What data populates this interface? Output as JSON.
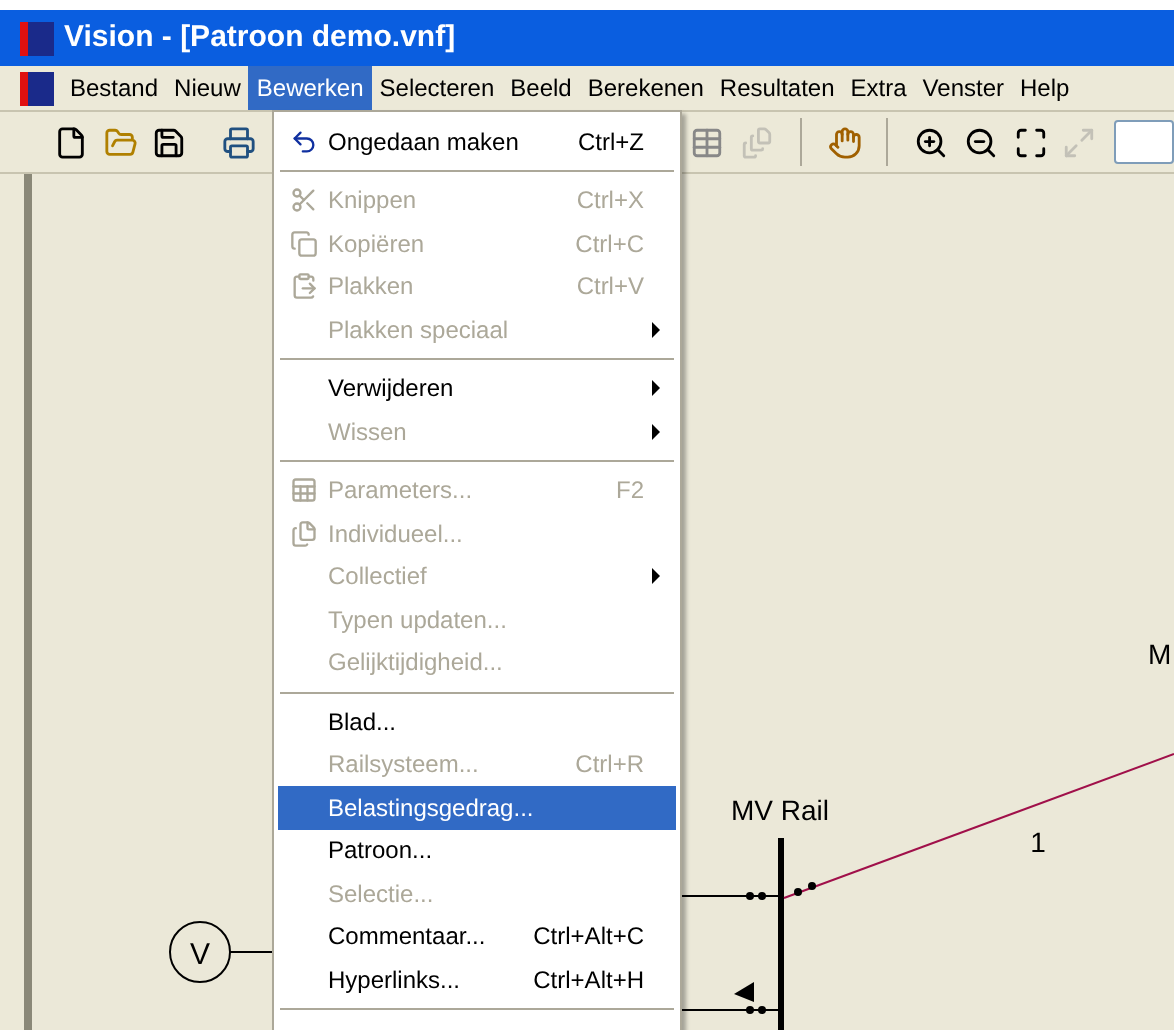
{
  "window": {
    "title": "Vision - [Patroon demo.vnf]"
  },
  "menu_bar": [
    {
      "label": "Bestand",
      "selected": false
    },
    {
      "label": "Nieuw",
      "selected": false
    },
    {
      "label": "Bewerken",
      "selected": true
    },
    {
      "label": "Selecteren",
      "selected": false
    },
    {
      "label": "Beeld",
      "selected": false
    },
    {
      "label": "Berekenen",
      "selected": false
    },
    {
      "label": "Resultaten",
      "selected": false
    },
    {
      "label": "Extra",
      "selected": false
    },
    {
      "label": "Venster",
      "selected": false
    },
    {
      "label": "Help",
      "selected": false
    }
  ],
  "menu": {
    "items": [
      {
        "kind": "item",
        "label": "Ongedaan maken",
        "shortcut": "Ctrl+Z",
        "disabled": false,
        "selected": false,
        "submenu": false
      },
      {
        "kind": "separator"
      },
      {
        "kind": "item",
        "label": "Knippen",
        "shortcut": "Ctrl+X",
        "disabled": true,
        "selected": false,
        "submenu": false
      },
      {
        "kind": "item",
        "label": "Kopiëren",
        "shortcut": "Ctrl+C",
        "disabled": true,
        "selected": false,
        "submenu": false
      },
      {
        "kind": "item",
        "label": "Plakken",
        "shortcut": "Ctrl+V",
        "disabled": true,
        "selected": false,
        "submenu": false
      },
      {
        "kind": "item",
        "label": "Plakken speciaal",
        "disabled": true,
        "selected": false,
        "submenu": true
      },
      {
        "kind": "separator"
      },
      {
        "kind": "item",
        "label": "Verwijderen",
        "disabled": false,
        "selected": false,
        "submenu": true
      },
      {
        "kind": "item",
        "label": "Wissen",
        "disabled": true,
        "selected": false,
        "submenu": true
      },
      {
        "kind": "separator"
      },
      {
        "kind": "item",
        "label": "Parameters...",
        "shortcut": "F2",
        "disabled": true,
        "selected": false,
        "submenu": false
      },
      {
        "kind": "item",
        "label": "Individueel...",
        "disabled": true,
        "selected": false,
        "submenu": false
      },
      {
        "kind": "item",
        "label": "Collectief",
        "disabled": true,
        "selected": false,
        "submenu": true
      },
      {
        "kind": "item",
        "label": "Typen updaten...",
        "disabled": true,
        "selected": false,
        "submenu": false
      },
      {
        "kind": "item",
        "label": "Gelijktijdigheid...",
        "disabled": true,
        "selected": false,
        "submenu": false
      },
      {
        "kind": "separator"
      },
      {
        "kind": "item",
        "label": "Blad...",
        "disabled": false,
        "selected": false,
        "submenu": false
      },
      {
        "kind": "item",
        "label": "Railsysteem...",
        "shortcut": "Ctrl+R",
        "disabled": true,
        "selected": false,
        "submenu": false
      },
      {
        "kind": "item",
        "label": "Belastingsgedrag...",
        "disabled": false,
        "selected": true,
        "submenu": false
      },
      {
        "kind": "item",
        "label": "Patroon...",
        "disabled": false,
        "selected": false,
        "submenu": false
      },
      {
        "kind": "item",
        "label": "Selectie...",
        "disabled": true,
        "selected": false,
        "submenu": false
      },
      {
        "kind": "item",
        "label": "Commentaar...",
        "shortcut": "Ctrl+Alt+C",
        "disabled": false,
        "selected": false,
        "submenu": false
      },
      {
        "kind": "item",
        "label": "Hyperlinks...",
        "shortcut": "Ctrl+Alt+H",
        "disabled": false,
        "selected": false,
        "submenu": false
      },
      {
        "kind": "separator"
      }
    ]
  },
  "diagram": {
    "rail_label": "MV Rail",
    "line_label": "1",
    "cut_label": "M",
    "source_label": "V"
  }
}
